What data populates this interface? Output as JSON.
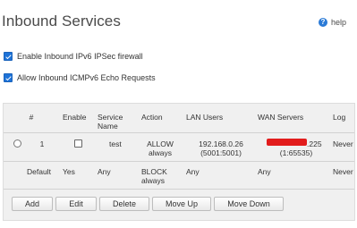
{
  "page": {
    "title": "Inbound Services",
    "help_label": "help",
    "help_icon": "?"
  },
  "options": [
    {
      "label": "Enable Inbound IPv6 IPSec firewall",
      "checked": true
    },
    {
      "label": "Allow Inbound ICMPv6 Echo Requests",
      "checked": true
    }
  ],
  "table": {
    "headers": {
      "num": "#",
      "enable": "Enable",
      "service_name_1": "Service",
      "service_name_2": "Name",
      "action": "Action",
      "lan_users": "LAN Users",
      "wan_servers": "WAN Servers",
      "log": "Log"
    },
    "row1": {
      "num": "1",
      "enable_checked": false,
      "service": "test",
      "action_1": "ALLOW",
      "action_2": "always",
      "lan_1": "192.168.0.26",
      "lan_2": "(5001:5001)",
      "wan_suffix": ".225",
      "wan_2": "(1:65535)",
      "log": "Never"
    },
    "default_row": {
      "label": "Default",
      "enable": "Yes",
      "service": "Any",
      "action_1": "BLOCK",
      "action_2": "always",
      "lan": "Any",
      "wan": "Any",
      "log": "Never"
    }
  },
  "buttons": {
    "add": "Add",
    "edit": "Edit",
    "delete": "Delete",
    "move_up": "Move Up",
    "move_down": "Move Down"
  },
  "colors": {
    "accent": "#1e73d8",
    "redaction": "#e21c1c",
    "panel_bg": "#f0f0f0"
  }
}
